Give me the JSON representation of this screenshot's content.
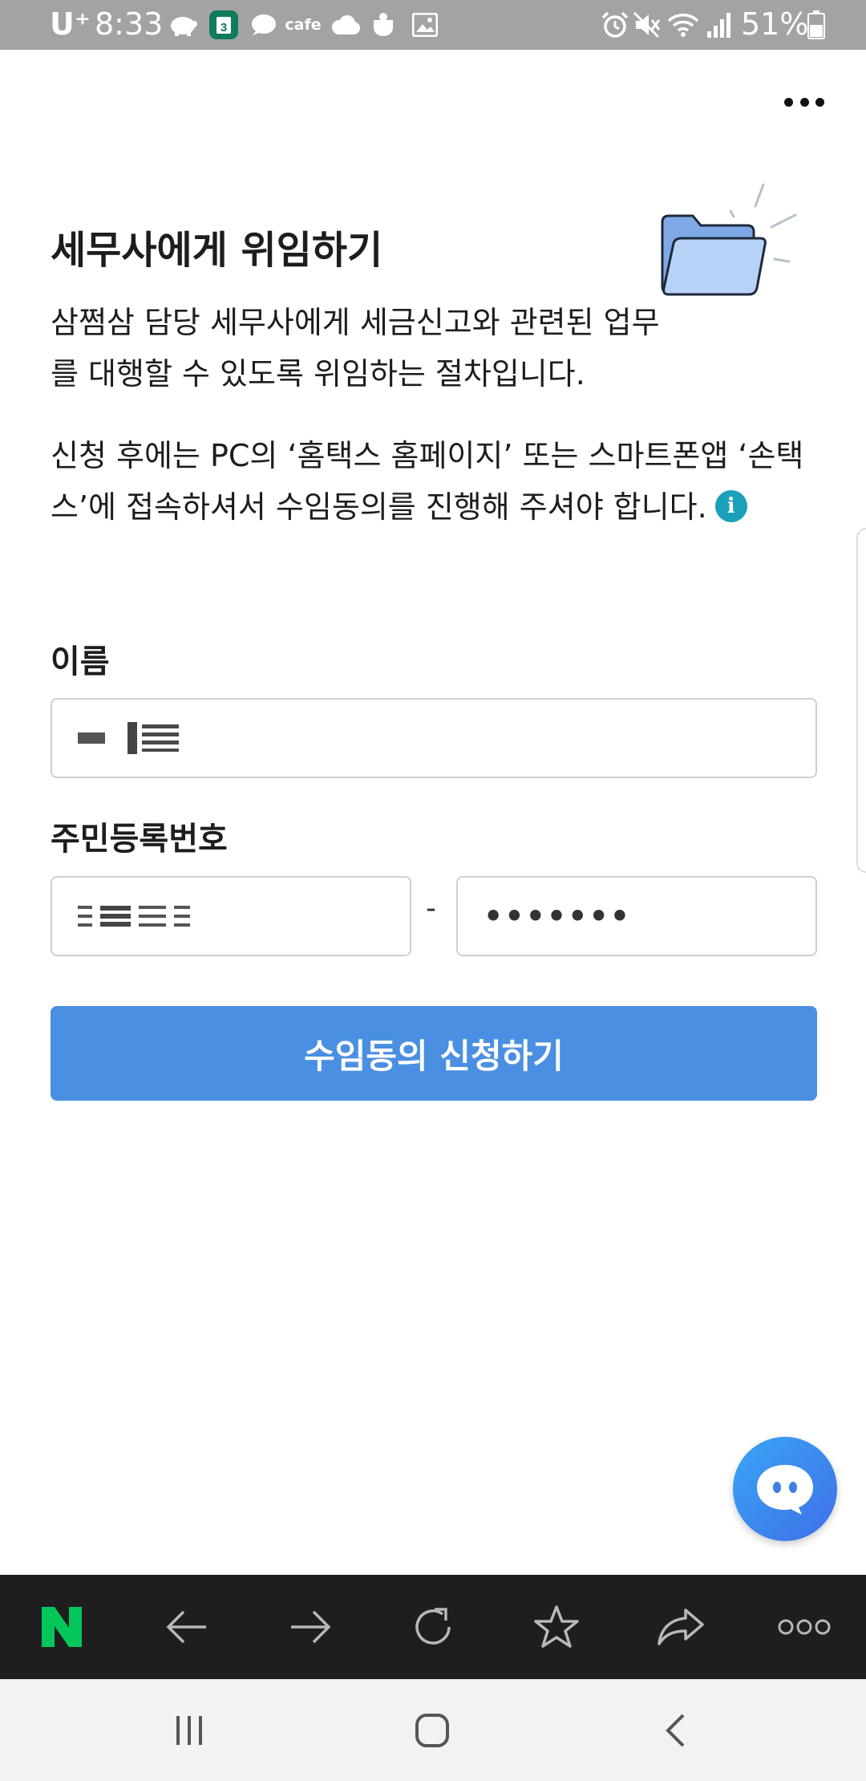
{
  "status_bar": {
    "carrier": "U⁺",
    "time": "8:33",
    "notification_badge": "3",
    "cafe_label": "cafe",
    "battery": "51%",
    "icons": [
      "piggy-bank-icon",
      "calendar-icon",
      "chat-bubble-icon",
      "cafe-icon",
      "cloud-icon",
      "coffee-icon",
      "gallery-icon",
      "alarm-icon",
      "mute-icon",
      "wifi-icon",
      "signal-icon",
      "battery-icon"
    ]
  },
  "header": {
    "menu_icon": "more-dots-icon"
  },
  "main": {
    "title": "세무사에게 위임하기",
    "illustration": "folder-icon",
    "description_1": "삼쩜삼 담당 세무사에게 세금신고와 관련된 업무를 대행할 수 있도록 위임하는 절차입니다.",
    "description_2": "신청 후에는 PC의 ‘홈택스 홈페이지’ 또는 스마트폰앱 ‘손택스’에 접속하셔서 수임동의를 진행해 주셔야 합니다.",
    "info_glyph": "i"
  },
  "form": {
    "name_label": "이름",
    "rrn_label": "주민등록번호",
    "rrn_separator": "-",
    "rrn_back_value": "•••••••",
    "submit_label": "수임동의 신청하기"
  },
  "chat": {
    "icon": "chatbot-icon"
  },
  "browser_toolbar": {
    "items": [
      "naver-logo-icon",
      "back-arrow-icon",
      "forward-arrow-icon",
      "refresh-icon",
      "star-icon",
      "share-icon",
      "more-icon"
    ],
    "logo_color": "#03c75a"
  },
  "nav_bar": {
    "items": [
      "recent-apps-icon",
      "home-icon",
      "back-icon"
    ]
  },
  "colors": {
    "accent": "#4a8fe2",
    "info": "#1aa0b8",
    "status_bar": "#a3a3a3",
    "toolbar": "#1e1e1e"
  }
}
